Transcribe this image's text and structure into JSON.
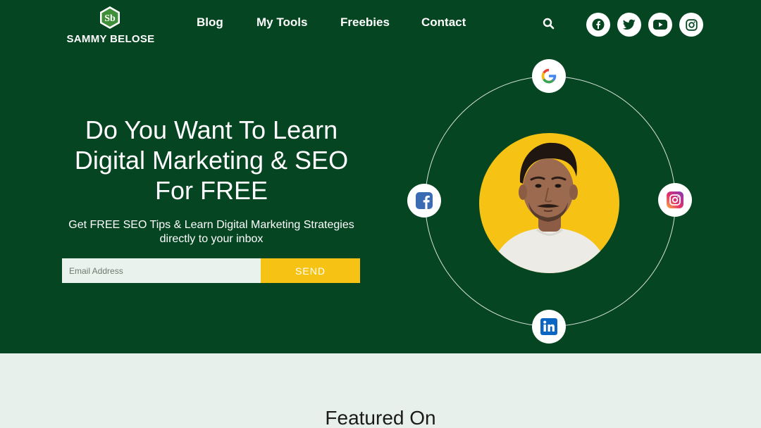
{
  "header": {
    "logo_text": "SAMMY BELOSE",
    "nav": [
      "Blog",
      "My Tools",
      "Freebies",
      "Contact"
    ],
    "icons": {
      "search": "search-icon",
      "social": [
        "facebook-icon",
        "twitter-icon",
        "youtube-icon",
        "instagram-icon"
      ]
    }
  },
  "hero": {
    "headline_line1": "Do You Want To Learn",
    "headline_line2": "Digital Marketing & SEO",
    "headline_line3": "For FREE",
    "subline_line1": "Get FREE SEO Tips & Learn Digital Marketing Strategies",
    "subline_line2": "directly to your inbox",
    "email_placeholder": "Email Address",
    "send_label": "SEND",
    "orbit_icons": [
      "google-icon",
      "facebook-icon",
      "instagram-icon",
      "linkedin-icon"
    ]
  },
  "section": {
    "featured_title": "Featured On"
  },
  "colors": {
    "hero_bg": "#054521",
    "accent_yellow": "#f6c214",
    "section_bg": "#e7f0ea"
  }
}
